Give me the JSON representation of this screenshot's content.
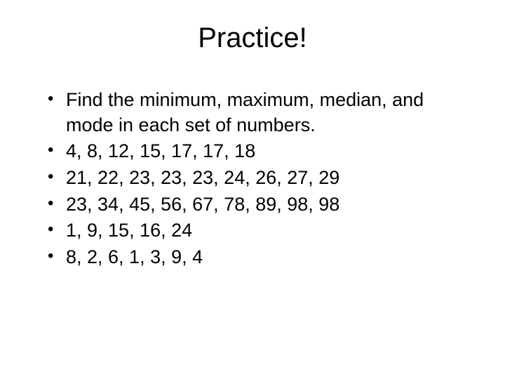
{
  "title": "Practice!",
  "bullets": [
    "Find the minimum, maximum, median, and mode in each set of numbers.",
    "4, 8, 12, 15, 17, 17, 18",
    "21, 22, 23, 23, 23, 24, 26, 27, 29",
    "23, 34, 45, 56, 67, 78, 89, 98, 98",
    "1, 9, 15, 16, 24",
    "8, 2, 6, 1, 3, 9, 4"
  ]
}
